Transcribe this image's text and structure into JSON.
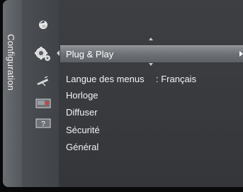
{
  "sidebar": {
    "title": "Configuration"
  },
  "icons": [
    {
      "name": "picture-icon"
    },
    {
      "name": "setup-gear-icon"
    },
    {
      "name": "channel-antenna-icon"
    },
    {
      "name": "input-icon"
    },
    {
      "name": "help-icon",
      "label": "?"
    }
  ],
  "menu": {
    "selected_label": "Plug & Play",
    "items": [
      {
        "label": "Langue des menus",
        "value": ": Français"
      },
      {
        "label": "Horloge",
        "value": ""
      },
      {
        "label": "Diffuser",
        "value": ""
      },
      {
        "label": "Sécurité",
        "value": ""
      },
      {
        "label": "Général",
        "value": ""
      }
    ]
  },
  "colors": {
    "panel": "#3a3c40",
    "selected_bar": "#7a7d82",
    "text": "#ffffff"
  }
}
